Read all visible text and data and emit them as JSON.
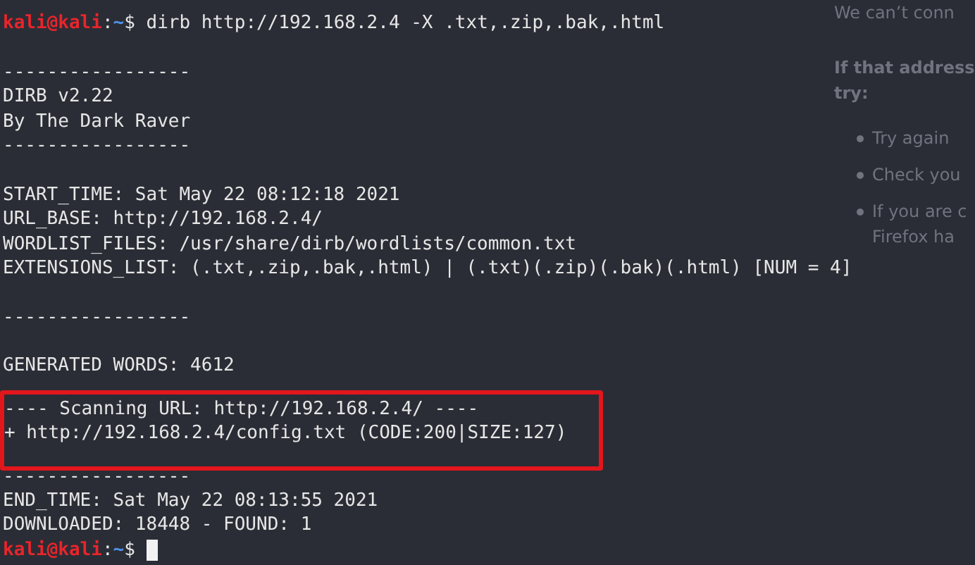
{
  "background_page": {
    "heading": "We can’t conn",
    "subheading": "If that address",
    "subheading_2": "try:",
    "bullets": [
      "Try again",
      "Check you",
      "If you are c"
    ],
    "bullet_continuation": "Firefox ha"
  },
  "terminal": {
    "lines": [
      {
        "kind": "prompt",
        "user": "kali@kali",
        "separator": ":",
        "path": "~",
        "symbol": "$",
        "text": "dirb http://192.168.2.4 -X .txt,.zip,.bak,.html"
      },
      {
        "kind": "blank"
      },
      {
        "kind": "text",
        "text": "-----------------"
      },
      {
        "kind": "text",
        "text": "DIRB v2.22"
      },
      {
        "kind": "text",
        "text": "By The Dark Raver"
      },
      {
        "kind": "text",
        "text": "-----------------"
      },
      {
        "kind": "blank"
      },
      {
        "kind": "text",
        "text": "START_TIME: Sat May 22 08:12:18 2021"
      },
      {
        "kind": "text",
        "text": "URL_BASE: http://192.168.2.4/"
      },
      {
        "kind": "text",
        "text": "WORDLIST_FILES: /usr/share/dirb/wordlists/common.txt"
      },
      {
        "kind": "text",
        "text": "EXTENSIONS_LIST: (.txt,.zip,.bak,.html) | (.txt)(.zip)(.bak)(.html) [NUM = 4]"
      },
      {
        "kind": "blank"
      },
      {
        "kind": "text",
        "text": "-----------------"
      },
      {
        "kind": "blank"
      },
      {
        "kind": "text",
        "text": "GENERATED WORDS: 4612"
      },
      {
        "kind": "highlight",
        "lines": [
          "---- Scanning URL: http://192.168.2.4/ ----",
          "+ http://192.168.2.4/config.txt (CODE:200|SIZE:127)"
        ]
      },
      {
        "kind": "text",
        "text": "-----------------"
      },
      {
        "kind": "text",
        "text": "END_TIME: Sat May 22 08:13:55 2021"
      },
      {
        "kind": "text",
        "text": "DOWNLOADED: 18448 - FOUND: 1"
      },
      {
        "kind": "prompt",
        "user": "kali@kali",
        "separator": ":",
        "path": "~",
        "symbol": "$",
        "cursor": true
      }
    ]
  }
}
